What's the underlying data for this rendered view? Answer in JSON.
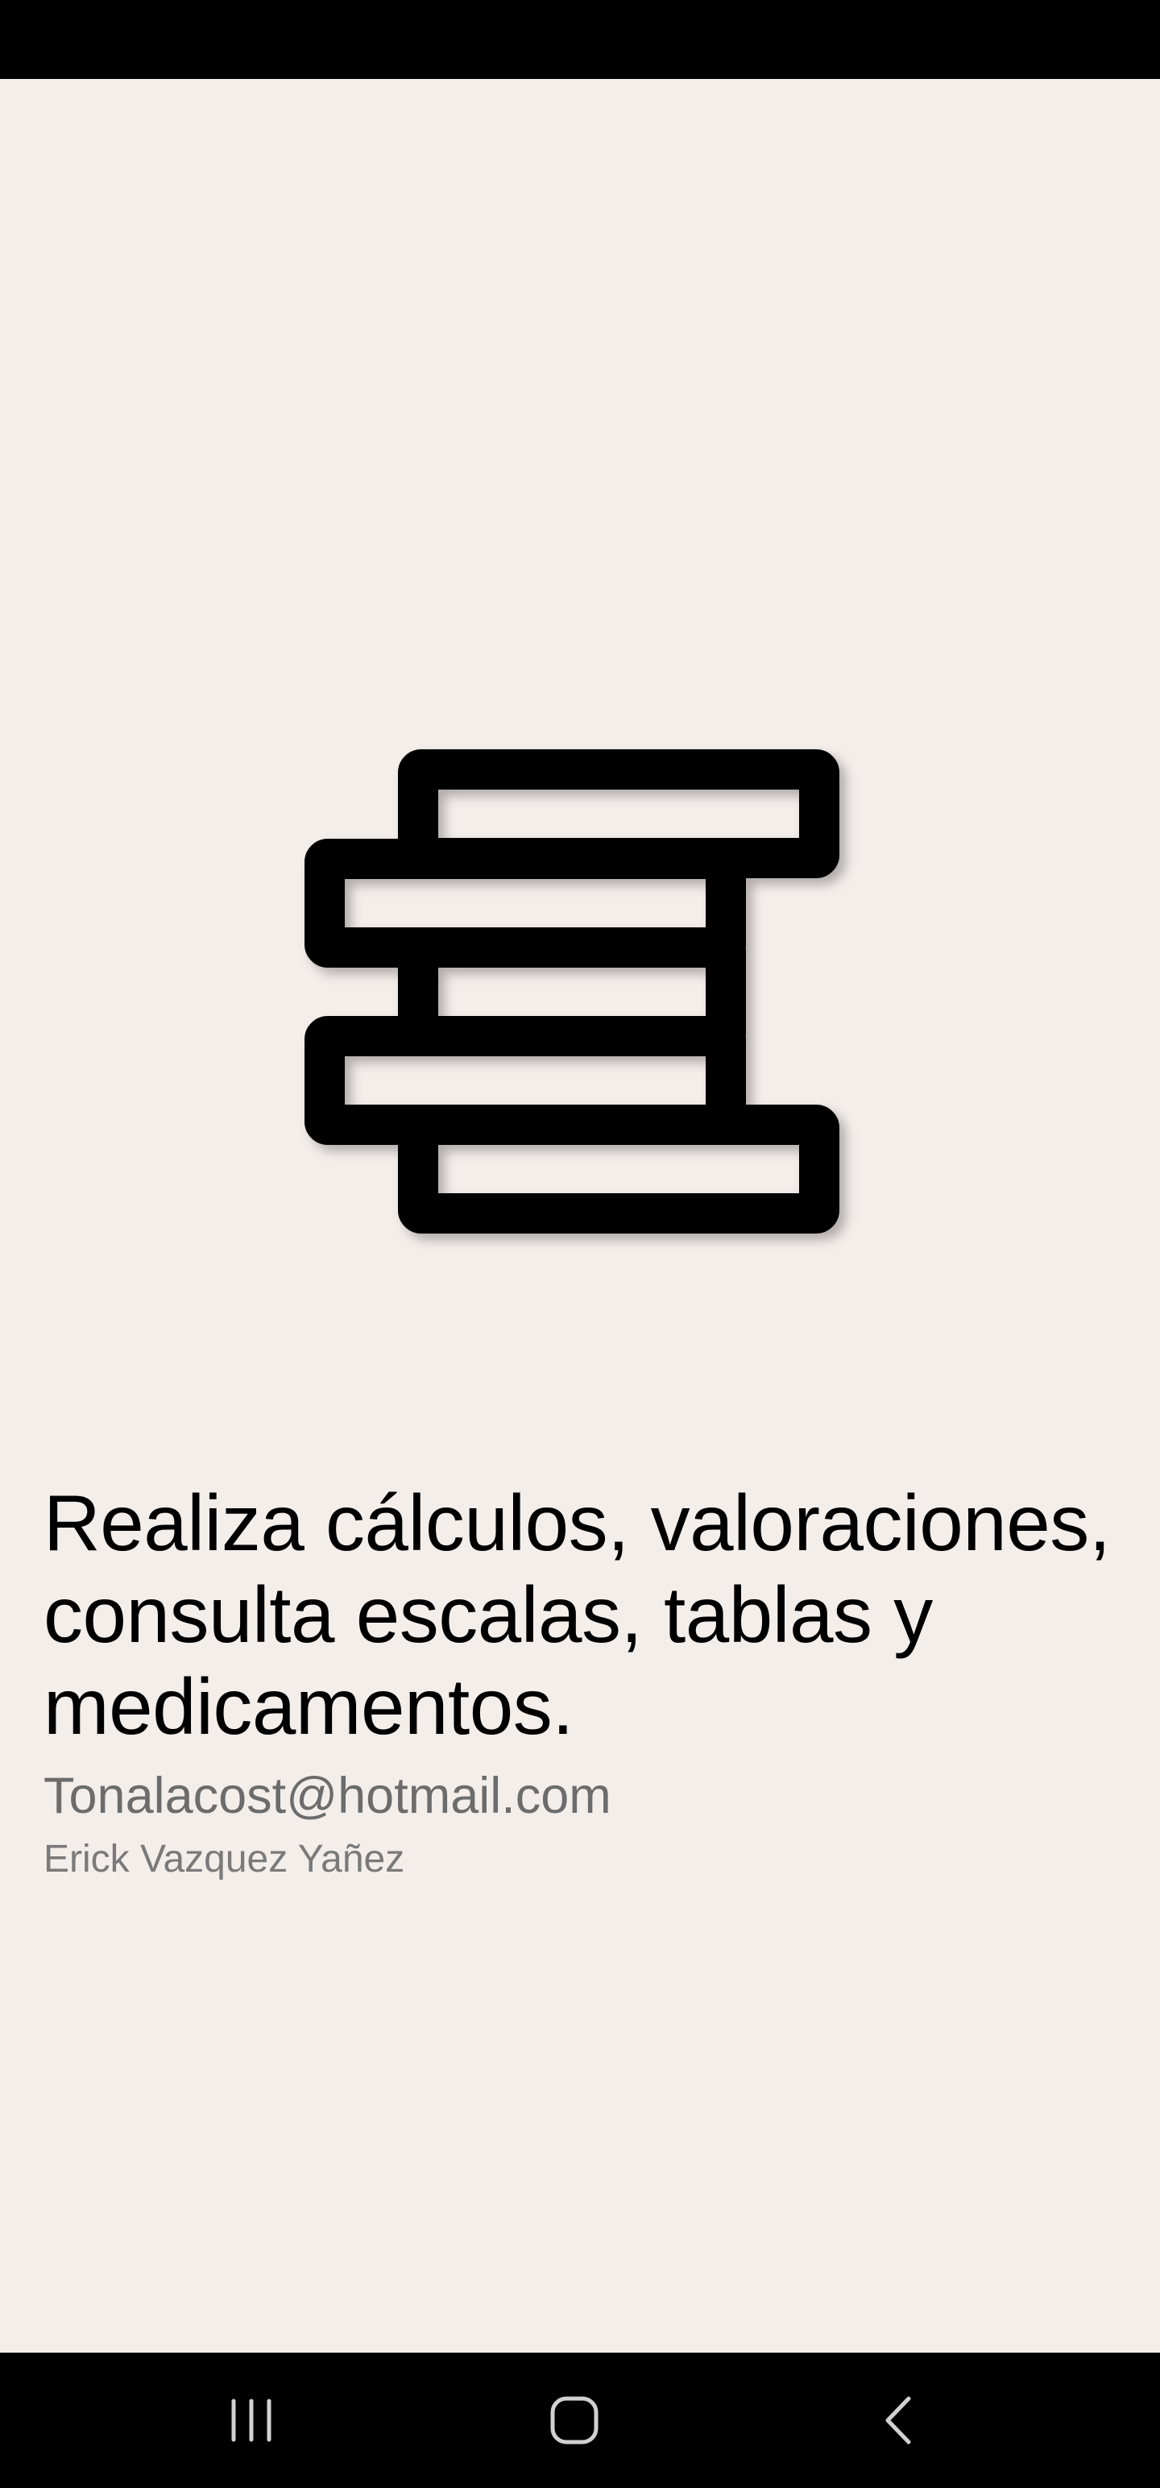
{
  "app": {
    "logo_icon": "stacked-e-logo-icon",
    "headline": "Realiza cálculos, valoraciones, consulta escalas, tablas y medicamentos.",
    "email": "Tonalacost@hotmail.com",
    "author": "Erick Vazquez Yañez"
  },
  "navigation_bar": {
    "recents_icon": "recents-icon",
    "home_icon": "home-icon",
    "back_icon": "back-icon"
  },
  "colors": {
    "background": "#f4eeeb",
    "system_bars": "#000000",
    "headline_text": "#000000",
    "email_text": "#6c6c6c",
    "author_text": "#7a7a7a"
  }
}
